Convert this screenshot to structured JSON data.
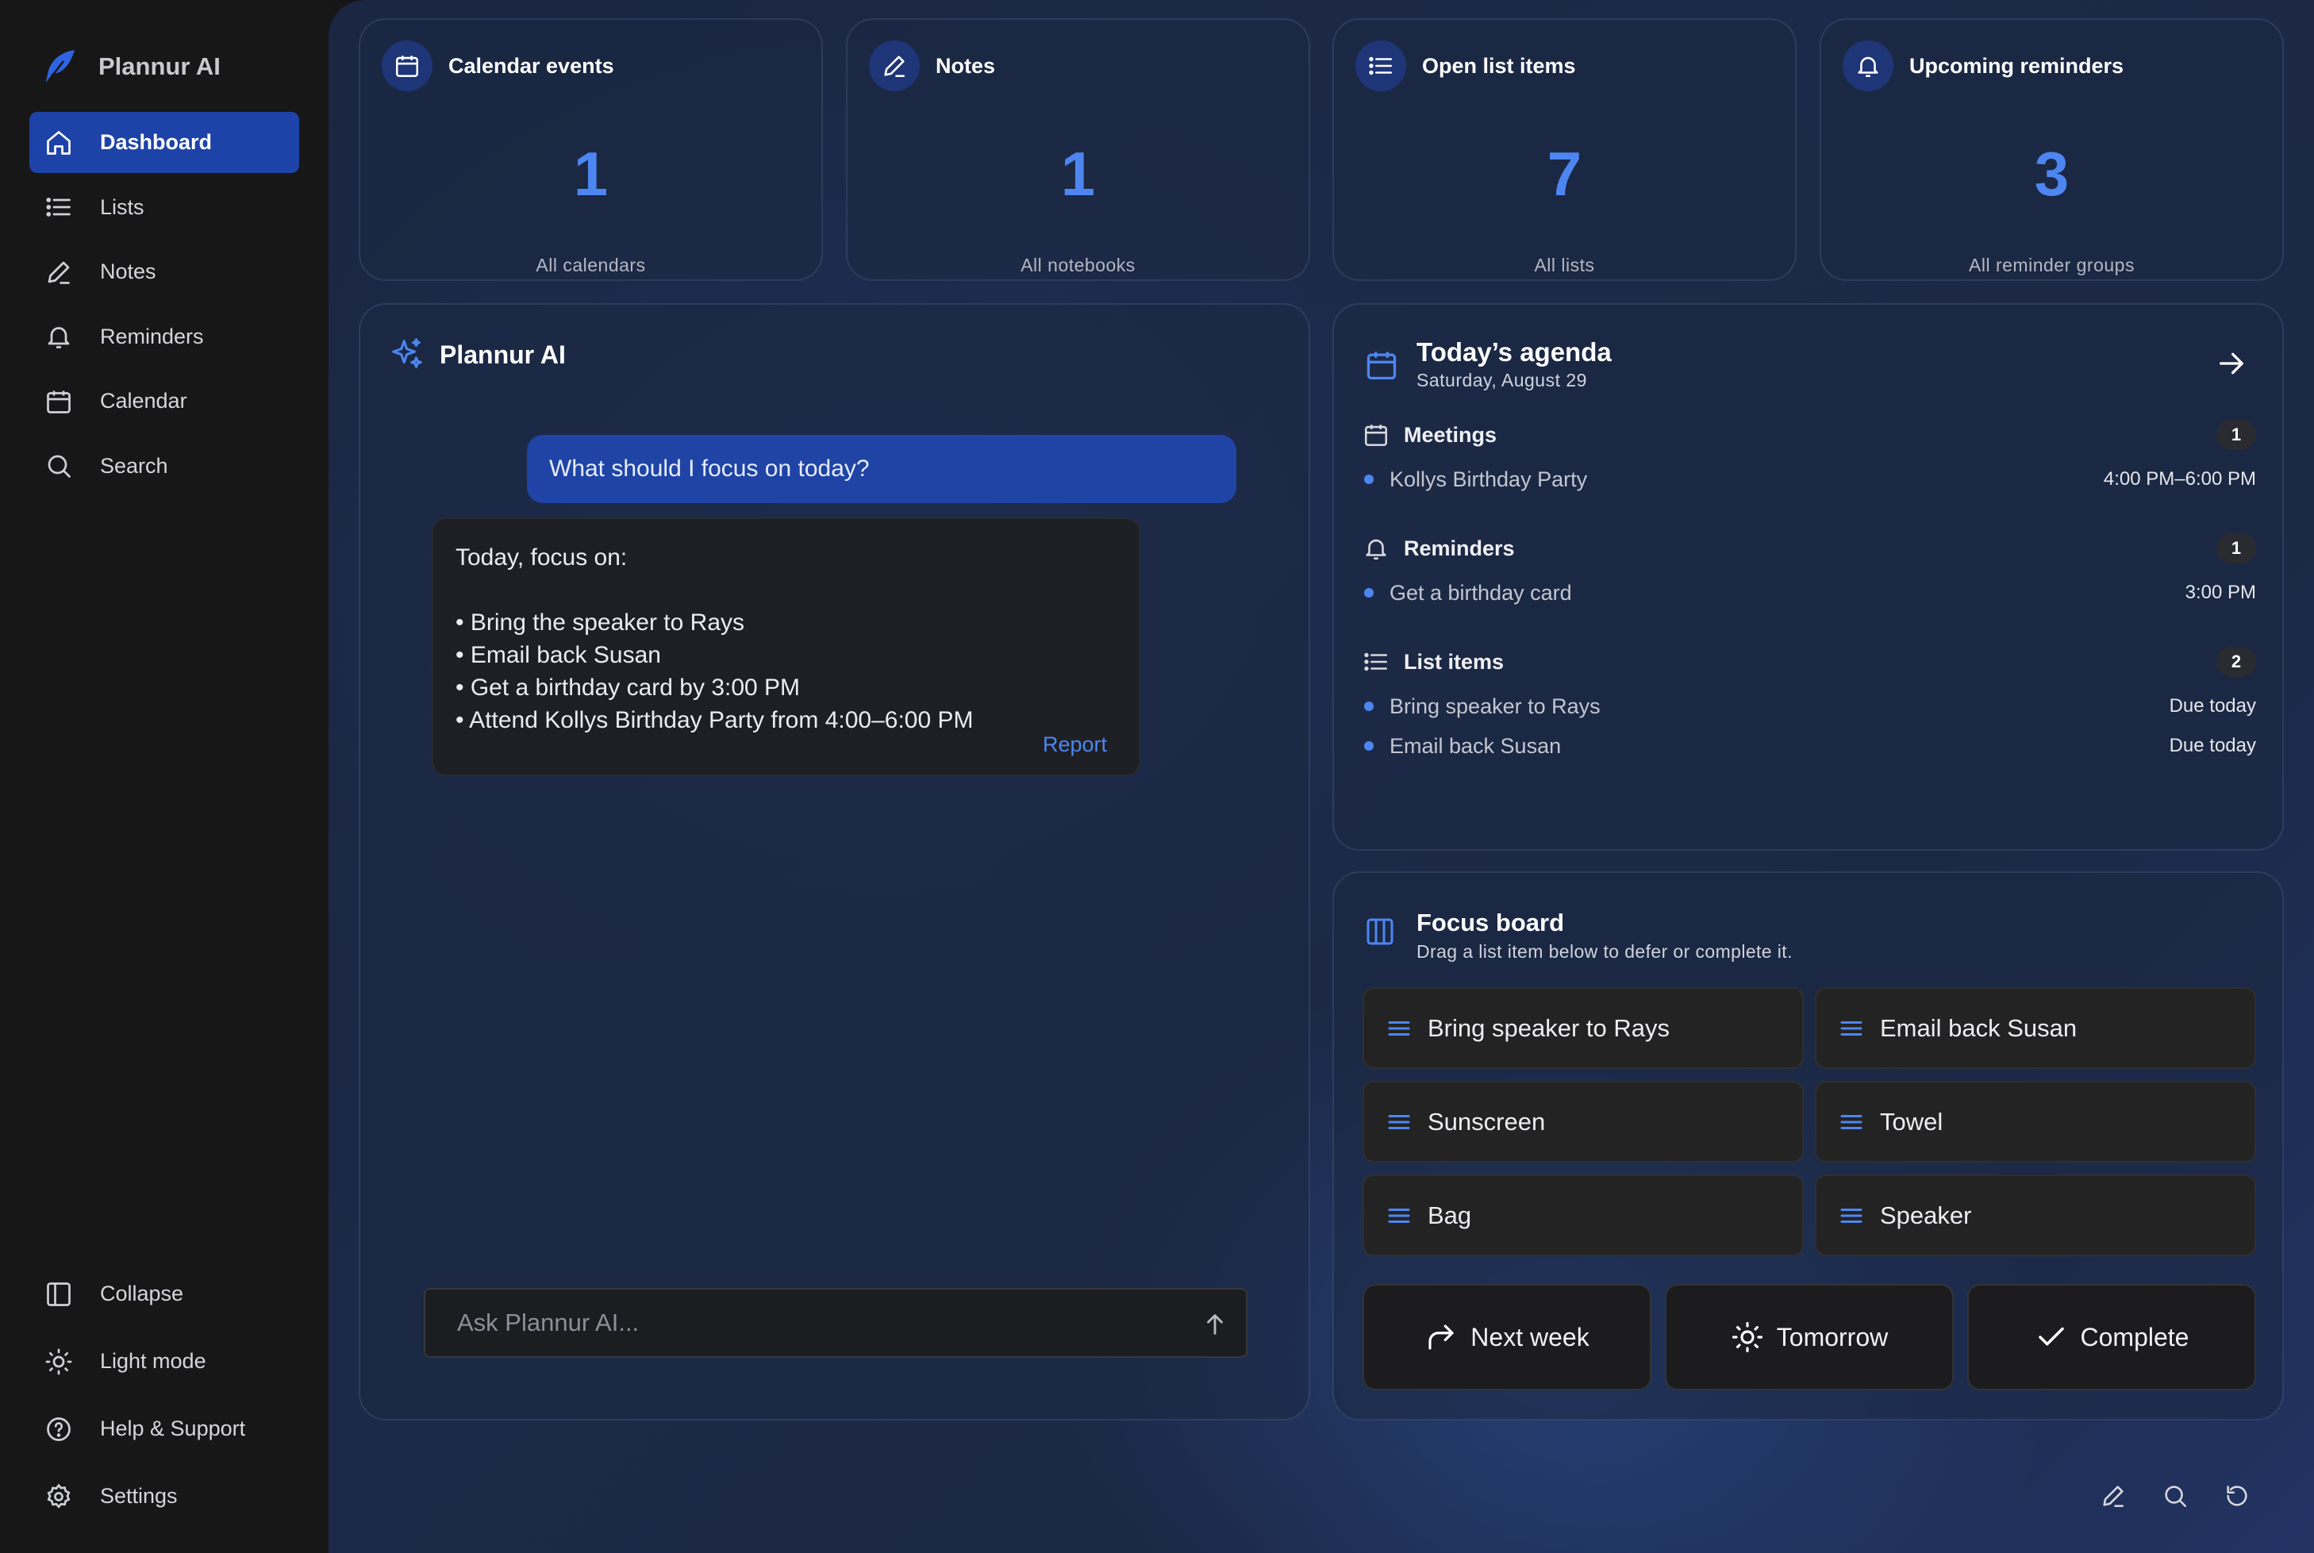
{
  "app": {
    "name": "Plannur AI"
  },
  "sidebar": {
    "items": [
      {
        "label": "Dashboard",
        "icon": "home-icon",
        "active": true
      },
      {
        "label": "Lists",
        "icon": "list-icon"
      },
      {
        "label": "Notes",
        "icon": "pen-icon"
      },
      {
        "label": "Reminders",
        "icon": "bell-icon"
      },
      {
        "label": "Calendar",
        "icon": "calendar-icon"
      },
      {
        "label": "Search",
        "icon": "search-icon"
      }
    ],
    "bottom": [
      {
        "label": "Collapse",
        "icon": "sidebar-panel-icon"
      },
      {
        "label": "Light mode",
        "icon": "sun-icon"
      },
      {
        "label": "Help & Support",
        "icon": "help-circle-icon"
      },
      {
        "label": "Settings",
        "icon": "gear-icon"
      }
    ]
  },
  "stats": [
    {
      "title": "Calendar events",
      "value": "1",
      "sub": "All calendars",
      "icon": "calendar-icon"
    },
    {
      "title": "Notes",
      "value": "1",
      "sub": "All notebooks",
      "icon": "pen-icon"
    },
    {
      "title": "Open list items",
      "value": "7",
      "sub": "All lists",
      "icon": "list-icon"
    },
    {
      "title": "Upcoming reminders",
      "value": "3",
      "sub": "All reminder groups",
      "icon": "bell-icon"
    }
  ],
  "chat": {
    "title": "Plannur AI",
    "user_message": "What should I focus on today?",
    "reply_intro": "Today, focus on:",
    "reply_items": [
      "• Bring the speaker to Rays",
      "• Email back Susan",
      "• Get a birthday card by 3:00 PM",
      "• Attend Kollys Birthday Party from 4:00–6:00 PM"
    ],
    "report_label": "Report",
    "input_placeholder": "Ask Plannur AI..."
  },
  "agenda": {
    "title": "Today’s agenda",
    "date": "Saturday, August 29",
    "sections": [
      {
        "label": "Meetings",
        "count": "1",
        "items": [
          {
            "name": "Kollys Birthday Party",
            "meta": "4:00 PM–6:00 PM"
          }
        ]
      },
      {
        "label": "Reminders",
        "count": "1",
        "items": [
          {
            "name": "Get a birthday card",
            "meta": "3:00 PM"
          }
        ]
      },
      {
        "label": "List items",
        "count": "2",
        "items": [
          {
            "name": "Bring speaker to Rays",
            "meta": "Due today"
          },
          {
            "name": "Email back Susan",
            "meta": "Due today"
          }
        ]
      }
    ]
  },
  "focus": {
    "title": "Focus board",
    "subtitle": "Drag a list item below to defer or complete it.",
    "items": [
      "Bring speaker to Rays",
      "Email back Susan",
      "Sunscreen",
      "Towel",
      "Bag",
      "Speaker"
    ],
    "actions": [
      {
        "label": "Next week",
        "icon": "redo-arrow-icon"
      },
      {
        "label": "Tomorrow",
        "icon": "sun-icon"
      },
      {
        "label": "Complete",
        "icon": "check-icon"
      }
    ]
  },
  "colors": {
    "accent": "#4d86f0",
    "active_nav": "#1e43a8",
    "sidebar_bg": "#171717"
  }
}
